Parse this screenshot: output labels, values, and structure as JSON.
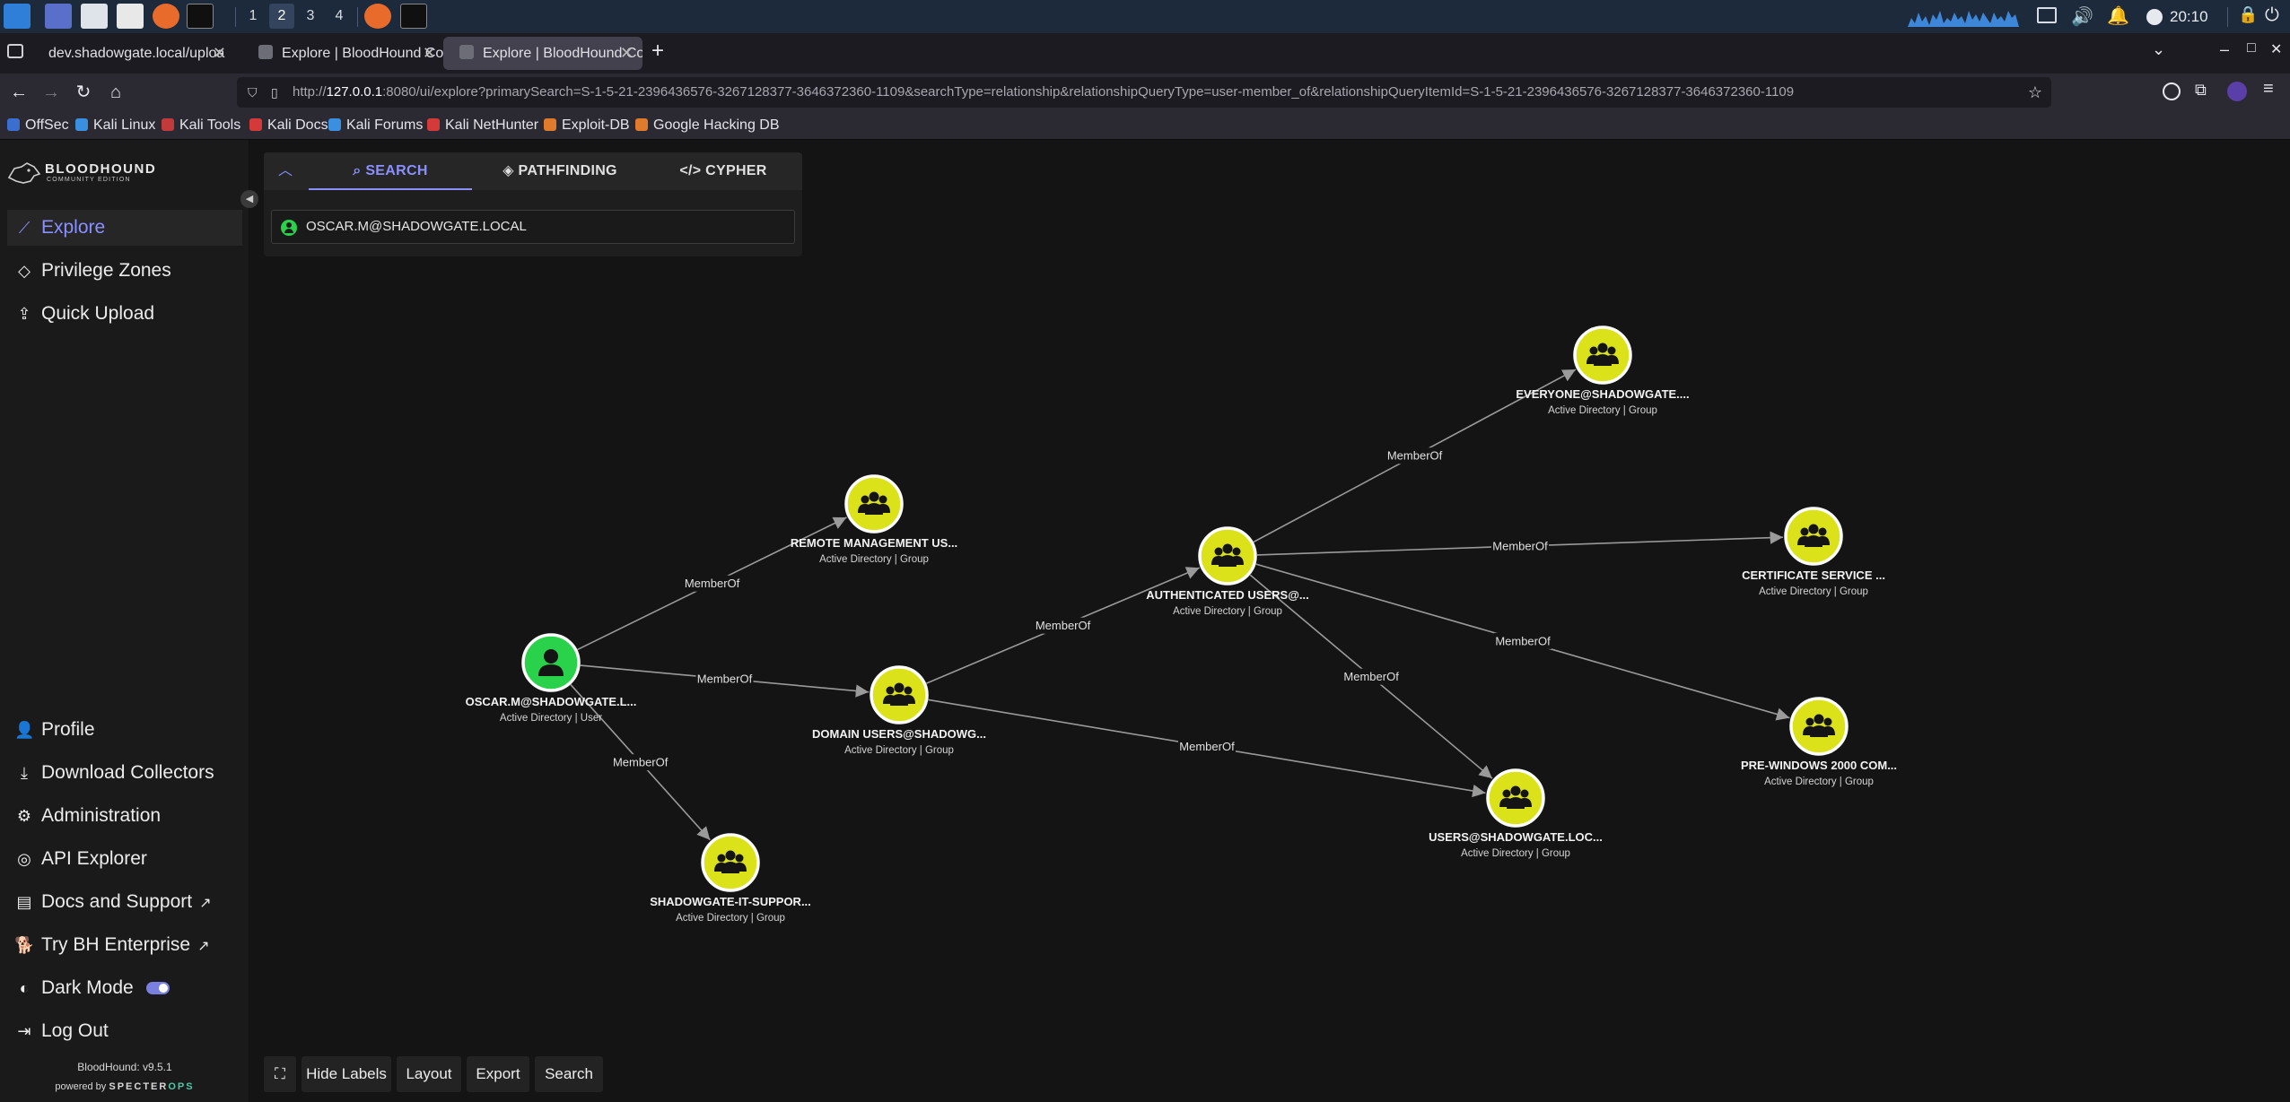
{
  "taskbar": {
    "workspaces": [
      "1",
      "2",
      "3",
      "4"
    ],
    "active_workspace": "2",
    "clock": "20:10"
  },
  "browser": {
    "tabs": [
      {
        "title": "dev.shadowgate.local/uploa",
        "active": false
      },
      {
        "title": "Explore | BloodHound Co",
        "active": false
      },
      {
        "title": "Explore | BloodHound Co",
        "active": true
      }
    ],
    "url": {
      "prefix": "http://",
      "host": "127.0.0.1",
      "rest": ":8080/ui/explore?primarySearch=S-1-5-21-2396436576-3267128377-3646372360-1109&searchType=relationship&relationshipQueryType=user-member_of&relationshipQueryItemId=S-1-5-21-2396436576-3267128377-3646372360-1109"
    },
    "bookmarks": [
      "OffSec",
      "Kali Linux",
      "Kali Tools",
      "Kali Docs",
      "Kali Forums",
      "Kali NetHunter",
      "Exploit-DB",
      "Google Hacking DB"
    ]
  },
  "app": {
    "logo_title": "BLOODHOUND",
    "logo_sub": "COMMUNITY EDITION",
    "nav_top": [
      {
        "label": "Explore",
        "active": true
      },
      {
        "label": "Privilege Zones",
        "active": false
      },
      {
        "label": "Quick Upload",
        "active": false
      }
    ],
    "nav_bottom": [
      "Profile",
      "Download Collectors",
      "Administration",
      "API Explorer",
      "Docs and Support",
      "Try BH Enterprise",
      "Dark Mode",
      "Log Out"
    ],
    "version": "BloodHound: v9.5.1",
    "powered_by": "powered by",
    "powered_brand": "SPECTER",
    "powered_brand_suffix": "OPS"
  },
  "search": {
    "tabs": [
      "SEARCH",
      "PATHFINDING",
      "CYPHER"
    ],
    "active_tab": "SEARCH",
    "value": "OSCAR.M@SHADOWGATE.LOCAL"
  },
  "graph": {
    "nodes": [
      {
        "id": "oscar",
        "label": "OSCAR.M@SHADOWGATE.L...",
        "subtitle": "Active Directory | User",
        "kind": "user",
        "color": "#2ad14a"
      },
      {
        "id": "remote",
        "label": "REMOTE MANAGEMENT US...",
        "subtitle": "Active Directory | Group",
        "kind": "group",
        "color": "#dbe21a"
      },
      {
        "id": "domainusers",
        "label": "DOMAIN USERS@SHADOWG...",
        "subtitle": "Active Directory | Group",
        "kind": "group",
        "color": "#dbe21a"
      },
      {
        "id": "itsupport",
        "label": "SHADOWGATE-IT-SUPPOR...",
        "subtitle": "Active Directory | Group",
        "kind": "group",
        "color": "#dbe21a"
      },
      {
        "id": "authusers",
        "label": "AUTHENTICATED USERS@...",
        "subtitle": "Active Directory | Group",
        "kind": "group",
        "color": "#dbe21a"
      },
      {
        "id": "everyone",
        "label": "EVERYONE@SHADOWGATE....",
        "subtitle": "Active Directory | Group",
        "kind": "group",
        "color": "#dbe21a"
      },
      {
        "id": "certsvc",
        "label": "CERTIFICATE SERVICE ...",
        "subtitle": "Active Directory | Group",
        "kind": "group",
        "color": "#dbe21a"
      },
      {
        "id": "prewin",
        "label": "PRE-WINDOWS 2000 COM...",
        "subtitle": "Active Directory | Group",
        "kind": "group",
        "color": "#dbe21a"
      },
      {
        "id": "users",
        "label": "USERS@SHADOWGATE.LOC...",
        "subtitle": "Active Directory | Group",
        "kind": "group",
        "color": "#dbe21a"
      }
    ],
    "edges": [
      {
        "from": "oscar",
        "to": "remote",
        "label": "MemberOf"
      },
      {
        "from": "oscar",
        "to": "domainusers",
        "label": "MemberOf"
      },
      {
        "from": "oscar",
        "to": "itsupport",
        "label": "MemberOf"
      },
      {
        "from": "domainusers",
        "to": "authusers",
        "label": "MemberOf"
      },
      {
        "from": "domainusers",
        "to": "users",
        "label": "MemberOf"
      },
      {
        "from": "authusers",
        "to": "everyone",
        "label": "MemberOf"
      },
      {
        "from": "authusers",
        "to": "certsvc",
        "label": "MemberOf"
      },
      {
        "from": "authusers",
        "to": "prewin",
        "label": "MemberOf"
      },
      {
        "from": "authusers",
        "to": "users",
        "label": "MemberOf"
      }
    ]
  },
  "toolbar": {
    "hide_labels": "Hide Labels",
    "layout": "Layout",
    "export": "Export",
    "search": "Search"
  }
}
